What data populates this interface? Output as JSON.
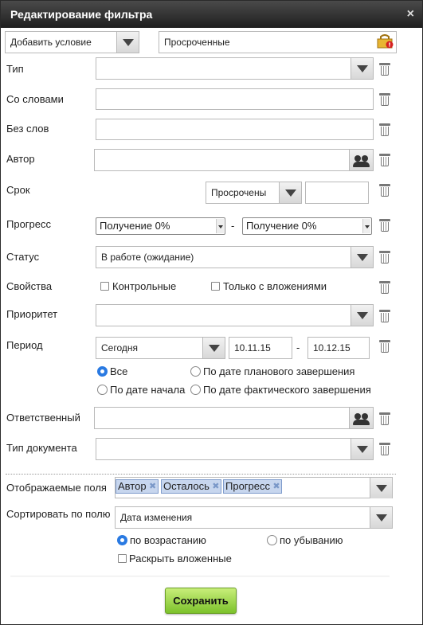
{
  "title": "Редактирование фильтра",
  "close_icon": "×",
  "add_condition": "Добавить условие",
  "filter_name": "Просроченные",
  "labels": {
    "type": "Тип",
    "with_words": "Со словами",
    "without_words": "Без слов",
    "author": "Автор",
    "deadline": "Срок",
    "progress": "Прогресс",
    "status": "Статус",
    "properties": "Свойства",
    "priority": "Приоритет",
    "period": "Период",
    "responsible": "Ответственный",
    "doc_type": "Тип документа",
    "displayed_fields": "Отображаемые поля",
    "sort_by": "Сортировать по полю"
  },
  "deadline_value": "Просрочены",
  "progress_from": "Получение 0%",
  "progress_to": "Получение 0%",
  "dash": "-",
  "status_value": "В работе (ожидание)",
  "prop_control": "Контрольные",
  "prop_attachments": "Только с вложениями",
  "period_value": "Сегодня",
  "date_from": "10.11.15",
  "date_to": "10.12.15",
  "period_options": {
    "all": "Все",
    "planned": "По дате планового завершения",
    "start": "По дате начала",
    "actual": "По дате фактического завершения"
  },
  "fields_tags": [
    "Автор",
    "Осталось",
    "Прогресс"
  ],
  "sort_value": "Дата изменения",
  "sort_asc": "по возрастанию",
  "sort_desc": "по убыванию",
  "expand_nested": "Раскрыть вложенные",
  "save_label": "Сохранить",
  "colors": {
    "accent": "#2a7ae2",
    "save": "#8fd13a",
    "tag": "#c7d6ee"
  }
}
